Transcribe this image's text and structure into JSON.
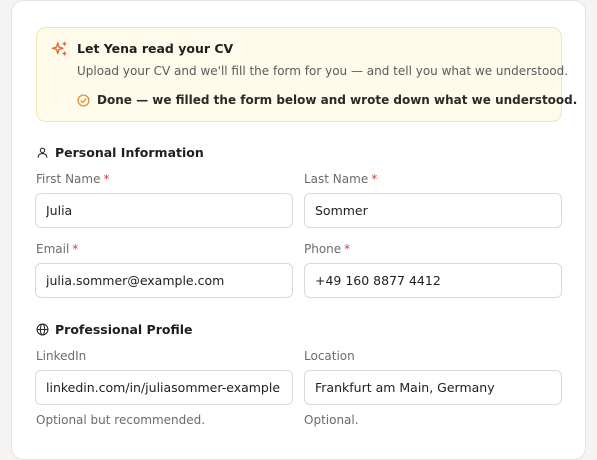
{
  "cv_upload": {
    "title": "Let Yena read your CV",
    "description": "Upload your CV and we'll fill the form for you — and tell you what we understood.",
    "status": "Done — we filled the form below and wrote down what we understood.",
    "accent_color": "#e06a3a",
    "status_color": "#e08a2a",
    "icon": "sparkle-icon",
    "status_icon": "check-circle-icon"
  },
  "personal": {
    "title": "Personal Information",
    "icon": "user-icon",
    "first_name": {
      "label": "First Name",
      "required_mark": "*",
      "value": "Julia"
    },
    "last_name": {
      "label": "Last Name",
      "required_mark": "*",
      "value": "Sommer"
    },
    "email": {
      "label": "Email",
      "required_mark": "*",
      "value": "julia.sommer@example.com"
    },
    "phone": {
      "label": "Phone",
      "required_mark": "*",
      "value": "+49 160 8877 4412"
    }
  },
  "professional": {
    "title": "Professional Profile",
    "icon": "globe-icon",
    "linkedin": {
      "label": "LinkedIn",
      "value": "linkedin.com/in/juliasommer-example",
      "hint": "Optional but recommended."
    },
    "location": {
      "label": "Location",
      "value": "Frankfurt am Main, Germany",
      "hint": "Optional."
    }
  }
}
